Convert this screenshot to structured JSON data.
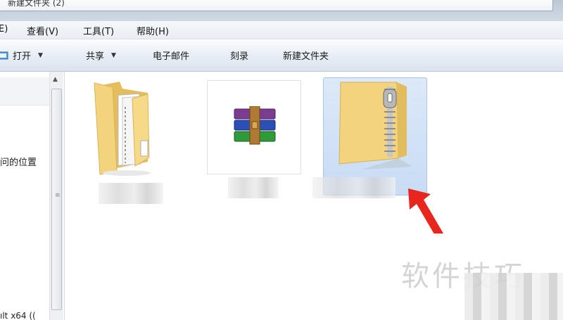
{
  "window": {
    "title_fragment": "新建文件夹 (2)"
  },
  "menu": {
    "items": [
      {
        "label": "E)"
      },
      {
        "label": "查看(V)"
      },
      {
        "label": "工具(T)"
      },
      {
        "label": "帮助(H)"
      }
    ]
  },
  "toolbar": {
    "open_label": "打开",
    "share_label": "共享",
    "email_label": "电子邮件",
    "burn_label": "刻录",
    "new_folder_label": "新建文件夹"
  },
  "nav": {
    "recent_fragment": "问的位置",
    "bottom_fragment": "ılt x64 (("
  },
  "watermark": {
    "text": "软件技巧"
  },
  "colors": {
    "folder": "#f3d37d",
    "selection": "#cfe0f6",
    "arrow": "#e8261e"
  }
}
